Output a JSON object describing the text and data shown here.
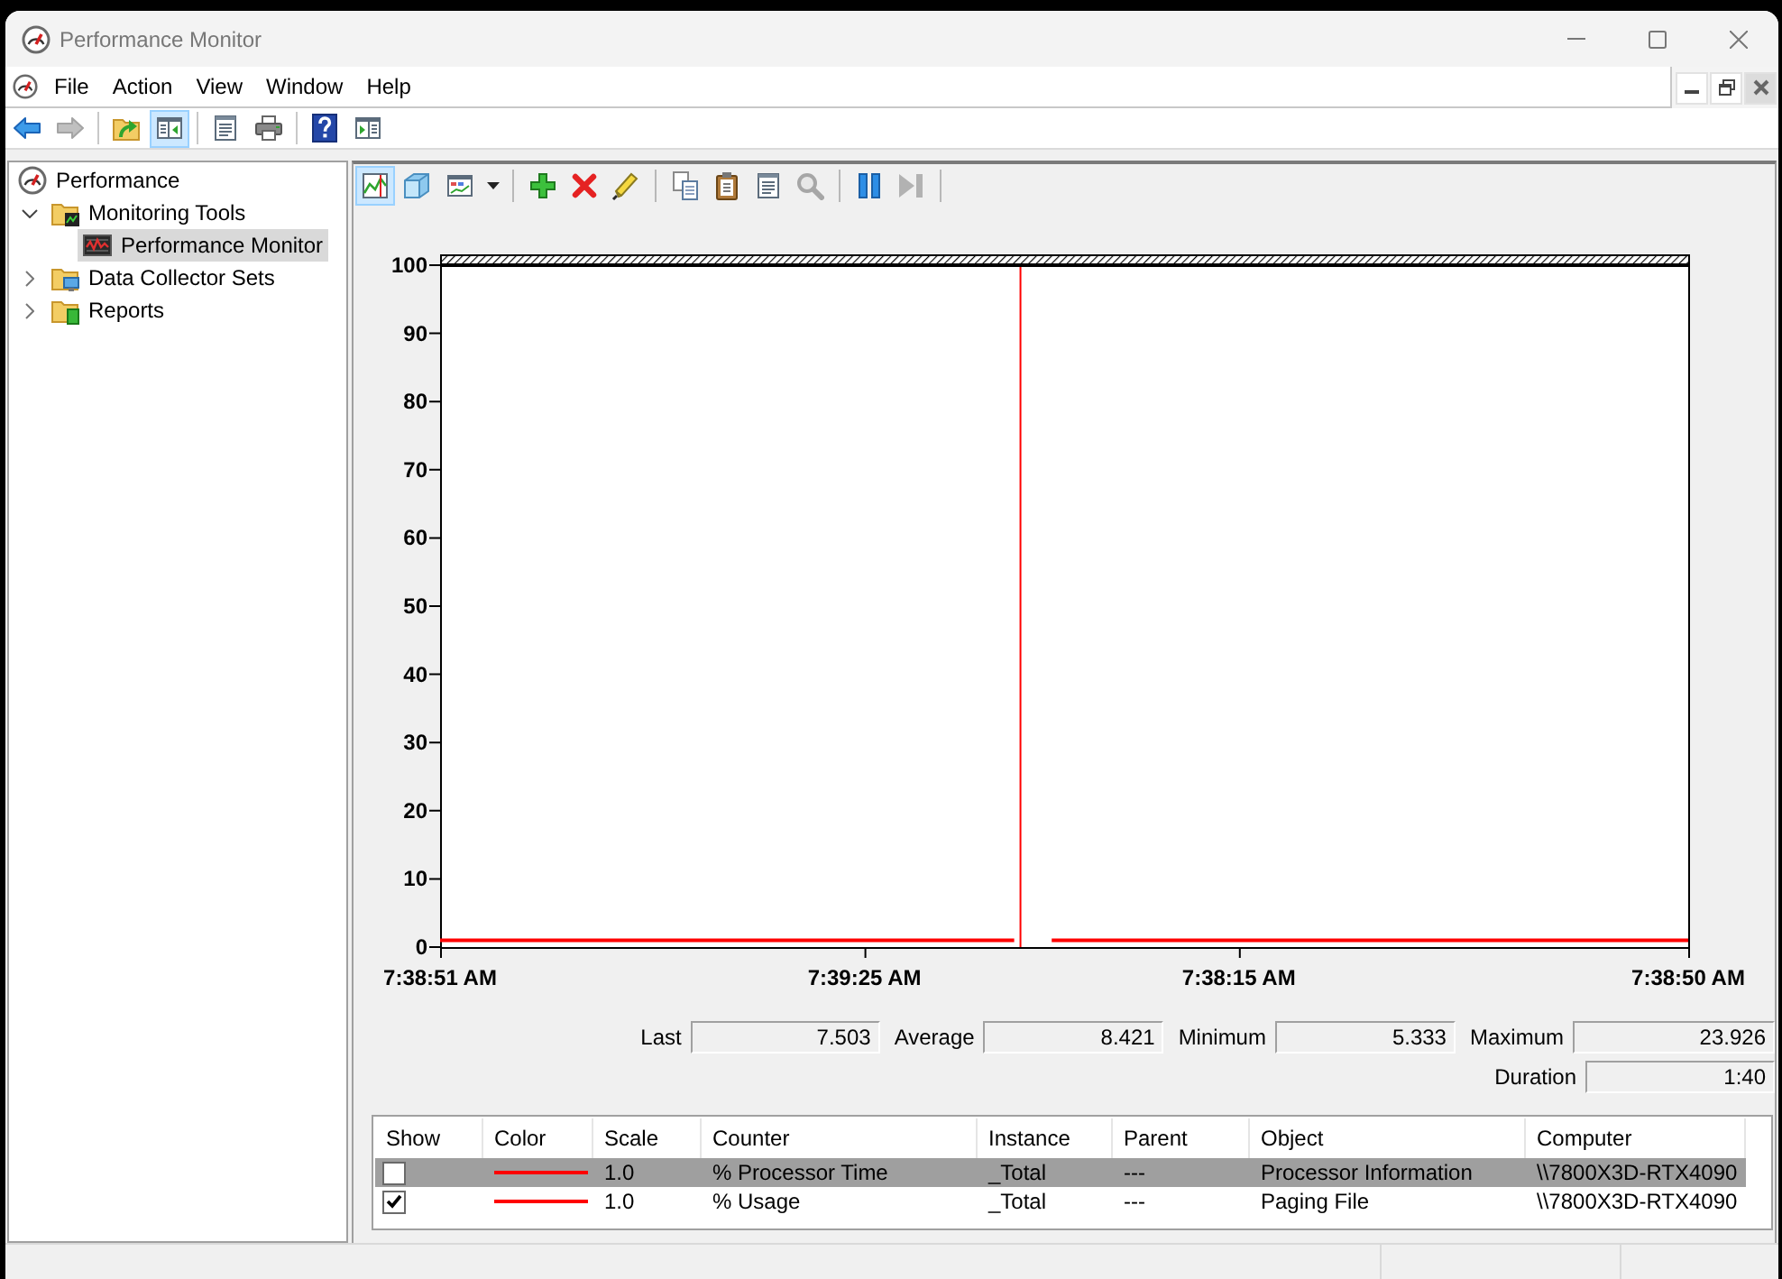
{
  "window": {
    "title": "Performance Monitor"
  },
  "menu_bar": {
    "items": [
      "File",
      "Action",
      "View",
      "Window",
      "Help"
    ]
  },
  "toolbar": {
    "buttons": [
      {
        "kind": "back",
        "selected": false,
        "disabled": false
      },
      {
        "kind": "forward",
        "selected": false,
        "disabled": true
      },
      {
        "kind": "separator"
      },
      {
        "kind": "up-folder",
        "selected": false,
        "disabled": false
      },
      {
        "kind": "console-tree",
        "selected": true,
        "disabled": false
      },
      {
        "kind": "separator"
      },
      {
        "kind": "properties",
        "selected": false,
        "disabled": false
      },
      {
        "kind": "print",
        "selected": false,
        "disabled": false
      },
      {
        "kind": "separator"
      },
      {
        "kind": "help",
        "selected": false,
        "disabled": false
      },
      {
        "kind": "action-pane",
        "selected": false,
        "disabled": false
      }
    ]
  },
  "console_tree": {
    "items": [
      {
        "label": "Performance",
        "kind": "gauge",
        "selected": false,
        "children": [
          {
            "label": "Monitoring Tools",
            "kind": "folder-graph",
            "selected": false,
            "expanded": true,
            "children": [
              {
                "label": "Performance Monitor",
                "kind": "graph",
                "selected": true
              }
            ]
          },
          {
            "label": "Data Collector Sets",
            "kind": "folder-screen",
            "selected": false,
            "expanded": false
          },
          {
            "label": "Reports",
            "kind": "folder-report",
            "selected": false,
            "expanded": false
          }
        ]
      }
    ]
  },
  "graph_toolbar": {
    "buttons": [
      {
        "kind": "graph-view",
        "selected": true,
        "disabled": false
      },
      {
        "kind": "histogram-view",
        "selected": false,
        "disabled": false
      },
      {
        "kind": "report-view",
        "selected": false,
        "disabled": false
      },
      {
        "kind": "separator"
      },
      {
        "kind": "add",
        "selected": false,
        "disabled": false
      },
      {
        "kind": "delete",
        "selected": false,
        "disabled": false
      },
      {
        "kind": "highlight",
        "selected": false,
        "disabled": false
      },
      {
        "kind": "separator"
      },
      {
        "kind": "copy",
        "selected": false,
        "disabled": false
      },
      {
        "kind": "paste",
        "selected": false,
        "disabled": false
      },
      {
        "kind": "properties",
        "selected": false,
        "disabled": false
      },
      {
        "kind": "zoom",
        "selected": false,
        "disabled": true
      },
      {
        "kind": "separator"
      },
      {
        "kind": "freeze",
        "selected": false,
        "disabled": false
      },
      {
        "kind": "update",
        "selected": false,
        "disabled": true
      },
      {
        "kind": "separator"
      }
    ]
  },
  "graph": {
    "chart_data": {
      "type": "line",
      "categories": [
        "7:38:51 AM",
        null,
        null,
        null,
        null,
        null,
        null,
        null,
        null,
        null,
        null,
        null,
        null,
        null,
        null,
        null,
        null,
        null,
        null,
        null,
        null,
        null,
        null,
        null,
        null,
        null,
        null,
        null,
        null,
        null,
        null,
        null,
        null,
        null,
        "7:39:25 AM",
        null,
        null,
        null,
        null,
        null,
        null,
        null,
        null,
        null,
        null,
        null,
        null,
        null,
        null,
        null,
        null,
        null,
        null,
        null,
        null,
        null,
        null,
        null,
        null,
        null,
        null,
        null,
        null,
        null,
        "7:38:15 AM",
        null,
        null,
        null,
        null,
        null,
        null,
        null,
        null,
        null,
        null,
        null,
        null,
        null,
        null,
        null,
        null,
        null,
        null,
        null,
        null,
        null,
        null,
        null,
        null,
        null,
        null,
        null,
        null,
        null,
        null,
        null,
        null,
        null,
        null,
        null,
        "7:38:50 AM"
      ],
      "series": [
        {
          "color": "#ff0000",
          "values": [
            1,
            1,
            1,
            1,
            1,
            1,
            1,
            1,
            1,
            1,
            1,
            1,
            1,
            1,
            1,
            1,
            1,
            1,
            1,
            1,
            1,
            1,
            1,
            1,
            1,
            1,
            1,
            1,
            1,
            1,
            1,
            1,
            1,
            1,
            1,
            1,
            1,
            1,
            1,
            1,
            1,
            1,
            1,
            1,
            1,
            1,
            1,
            null,
            null,
            1,
            1,
            1,
            1,
            1,
            1,
            1,
            1,
            1,
            1,
            1,
            1,
            1,
            1,
            1,
            1,
            1,
            1,
            1,
            1,
            1,
            1,
            1,
            1,
            1,
            1,
            1,
            1,
            1,
            1,
            1,
            1,
            1,
            1,
            1,
            1,
            1,
            1,
            1,
            1,
            1,
            1,
            1,
            1,
            1,
            1,
            1,
            1,
            1,
            1,
            1,
            1
          ]
        }
      ],
      "ylim": [
        0,
        100
      ],
      "yticks": [
        0,
        10,
        20,
        30,
        40,
        50,
        60,
        70,
        80,
        90,
        100
      ]
    }
  },
  "statistics": {
    "items": [
      {
        "label": "Last",
        "value": "7.503"
      },
      {
        "label": "Average",
        "value": "8.421"
      },
      {
        "label": "Minimum",
        "value": "5.333"
      },
      {
        "label": "Maximum",
        "value": "23.926"
      }
    ],
    "duration": {
      "label": "Duration",
      "value": "1:40"
    }
  },
  "legend": {
    "columns": [
      "Show",
      "Color",
      "Scale",
      "Counter",
      "Instance",
      "Parent",
      "Object",
      "Computer"
    ],
    "rows": [
      {
        "show": false,
        "selected": true,
        "color": "#ff0000",
        "scale": "1.0",
        "counter": "% Processor Time",
        "instance": "_Total",
        "parent": "---",
        "object": "Processor Information",
        "computer": "\\\\7800X3D-RTX4090"
      },
      {
        "show": true,
        "selected": false,
        "color": "#ff0000",
        "scale": "1.0",
        "counter": "% Usage",
        "instance": "_Total",
        "parent": "---",
        "object": "Paging File",
        "computer": "\\\\7800X3D-RTX4090"
      }
    ]
  }
}
